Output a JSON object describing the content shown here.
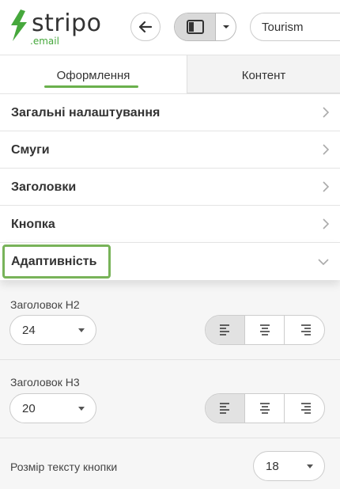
{
  "app": {
    "logo_name": "stripo",
    "logo_suffix": ".email",
    "brand_color": "#46a83c",
    "search_value": "Tourism"
  },
  "tabs": [
    {
      "label": "Оформлення",
      "active": true
    },
    {
      "label": "Контент",
      "active": false
    }
  ],
  "sections": [
    {
      "label": "Загальні налаштування",
      "expanded": false
    },
    {
      "label": "Смуги",
      "expanded": false
    },
    {
      "label": "Заголовки",
      "expanded": false
    },
    {
      "label": "Кнопка",
      "expanded": false
    },
    {
      "label": "Адаптивність",
      "expanded": true
    }
  ],
  "adaptive": {
    "h2": {
      "label": "Заголовок H2",
      "value": "24",
      "align": "left"
    },
    "h3": {
      "label": "Заголовок H3",
      "value": "20",
      "align": "left"
    },
    "button_text": {
      "label": "Розмір тексту кнопки",
      "value": "18"
    }
  },
  "icons": {
    "back": "arrow-left-icon",
    "layout": "layout-panel-icon",
    "dropdown": "chevron-down-icon",
    "align_left": "align-left-icon",
    "align_center": "align-center-icon",
    "align_right": "align-right-icon"
  }
}
